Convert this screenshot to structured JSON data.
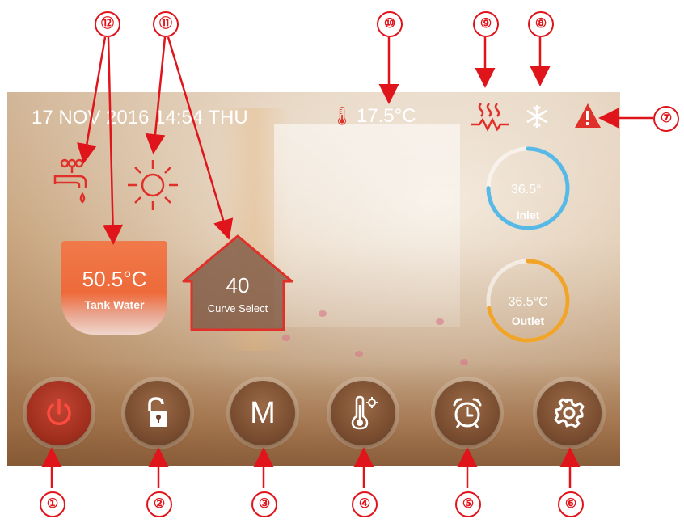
{
  "header": {
    "datetime": "17 NOV 2016 14:54 THU",
    "ambient_temp": "17.5°C"
  },
  "tank": {
    "value": "50.5°C",
    "label": "Tank Water"
  },
  "curve": {
    "value": "40",
    "label": "Curve Select"
  },
  "gauges": {
    "inlet": {
      "value": "36.5°",
      "label": "Inlet",
      "color": "#59b9e6",
      "level": 0.75
    },
    "outlet": {
      "value": "36.5°C",
      "label": "Outlet",
      "color": "#f0a52a",
      "level": 0.72
    }
  },
  "buttons": [
    {
      "name": "power",
      "icon": "power-icon"
    },
    {
      "name": "lock",
      "icon": "unlock-icon"
    },
    {
      "name": "mode",
      "label": "M"
    },
    {
      "name": "temp-settings",
      "icon": "thermometer-gear-icon"
    },
    {
      "name": "timer",
      "icon": "alarm-clock-icon"
    },
    {
      "name": "settings",
      "icon": "gear-icon"
    }
  ],
  "status_icons": [
    "tap-water-icon",
    "sun-icon",
    "heating-icon",
    "defrost-icon",
    "alarm-warning-icon"
  ],
  "annotations": [
    "①",
    "②",
    "③",
    "④",
    "⑤",
    "⑥",
    "⑦",
    "⑧",
    "⑨",
    "⑩",
    "⑪",
    "⑫"
  ],
  "colors": {
    "accent_red": "#e0302a",
    "annotation_red": "#e0141b",
    "tank_orange": "#ee6a3a"
  }
}
